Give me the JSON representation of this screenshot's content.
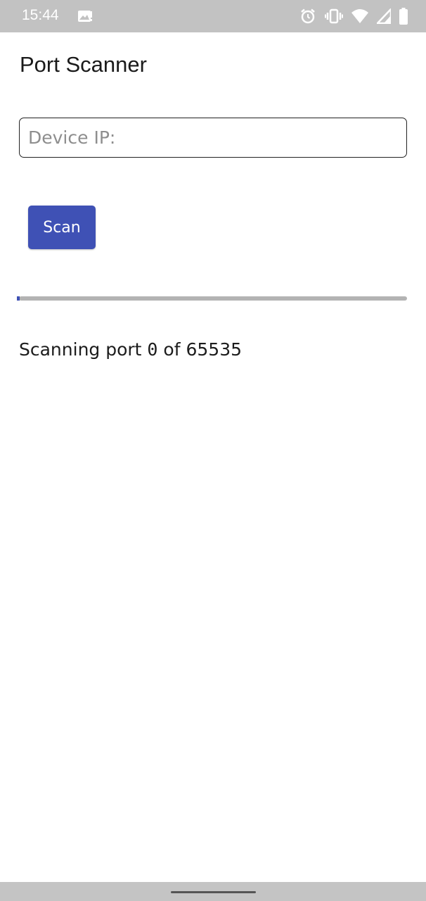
{
  "status_bar": {
    "time": "15:44",
    "background": "#c2c2c2",
    "icons": [
      "image-notification-icon",
      "alarm-icon",
      "vibrate-icon",
      "wifi-icon",
      "cell-signal-icon",
      "battery-icon"
    ]
  },
  "app": {
    "title": "Port Scanner",
    "accent": "#3f51b5"
  },
  "ip_input": {
    "placeholder": "Device IP:",
    "value": ""
  },
  "scan_button": {
    "label": "Scan"
  },
  "progress": {
    "fraction": 0
  },
  "status": {
    "prefix": "Scanning port ",
    "current_port": "0",
    "middle": " of ",
    "total_ports": "65535"
  }
}
